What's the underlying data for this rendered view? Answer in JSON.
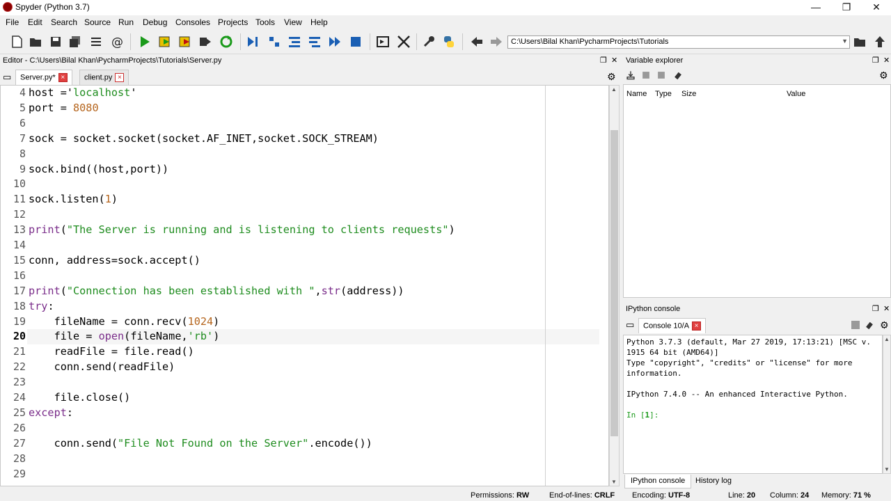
{
  "window": {
    "title": "Spyder (Python 3.7)",
    "minimize": "—",
    "restore": "❐",
    "close": "✕"
  },
  "menu": [
    "File",
    "Edit",
    "Search",
    "Source",
    "Run",
    "Debug",
    "Consoles",
    "Projects",
    "Tools",
    "View",
    "Help"
  ],
  "toolbar": {
    "path": "C:\\Users\\Bilal Khan\\PycharmProjects\\Tutorials"
  },
  "editor": {
    "header": "Editor - C:\\Users\\Bilal Khan\\PycharmProjects\\Tutorials\\Server.py",
    "tabs": [
      "Server.py*",
      "client.py"
    ],
    "current_line": "20",
    "lines": [
      {
        "n": "4",
        "html": "host ='<span class=\"str\">localhost</span>'"
      },
      {
        "n": "5",
        "html": "port = <span class=\"num\">8080</span>"
      },
      {
        "n": "6",
        "html": ""
      },
      {
        "n": "7",
        "html": "sock = socket.socket(socket.AF_INET,socket.SOCK_STREAM)"
      },
      {
        "n": "8",
        "html": ""
      },
      {
        "n": "9",
        "html": "sock.bind((host,port))"
      },
      {
        "n": "10",
        "html": ""
      },
      {
        "n": "11",
        "html": "sock.listen(<span class=\"num\">1</span>)"
      },
      {
        "n": "12",
        "html": ""
      },
      {
        "n": "13",
        "html": "<span class=\"kw\">print</span>(<span class=\"str\">\"The Server is running and is listening to clients requests\"</span>)"
      },
      {
        "n": "14",
        "html": ""
      },
      {
        "n": "15",
        "html": "conn, address=sock.accept()"
      },
      {
        "n": "16",
        "html": ""
      },
      {
        "n": "17",
        "html": "<span class=\"kw\">print</span>(<span class=\"str\">\"Connection has been established with \"</span>,<span class=\"kw\">str</span>(address))"
      },
      {
        "n": "18",
        "html": "<span class=\"kw\">try</span>:"
      },
      {
        "n": "19",
        "html": "    fileName = conn.recv(<span class=\"num\">1024</span>)"
      },
      {
        "n": "20",
        "html": "    file = <span class=\"kw\">open</span>(fileName,<span class=\"str\">'rb'</span>)"
      },
      {
        "n": "21",
        "html": "    readFile = file.read()"
      },
      {
        "n": "22",
        "html": "    conn.send(readFile)"
      },
      {
        "n": "23",
        "html": ""
      },
      {
        "n": "24",
        "html": "    file.close()"
      },
      {
        "n": "25",
        "html": "<span class=\"kw\">except</span>:"
      },
      {
        "n": "26",
        "html": ""
      },
      {
        "n": "27",
        "html": "    conn.send(<span class=\"str\">\"File Not Found on the Server\"</span>.encode())"
      },
      {
        "n": "28",
        "html": ""
      },
      {
        "n": "29",
        "html": ""
      }
    ]
  },
  "variable_explorer": {
    "title": "Variable explorer",
    "columns": [
      "Name",
      "Type",
      "Size",
      "Value"
    ]
  },
  "ipython": {
    "title": "IPython console",
    "tab": "Console 10/A",
    "output": [
      "Python 3.7.3 (default, Mar 27 2019, 17:13:21) [MSC v.",
      "1915 64 bit (AMD64)]",
      "Type \"copyright\", \"credits\" or \"license\" for more",
      "information.",
      "",
      "IPython 7.4.0 -- An enhanced Interactive Python.",
      "",
      "In [1]:"
    ],
    "bottom_tabs": [
      "IPython console",
      "History log"
    ]
  },
  "status": {
    "permissions_label": "Permissions:",
    "permissions": "RW",
    "eol_label": "End-of-lines:",
    "eol": "CRLF",
    "encoding_label": "Encoding:",
    "encoding": "UTF-8",
    "line_label": "Line:",
    "line": "20",
    "column_label": "Column:",
    "column": "24",
    "memory_label": "Memory:",
    "memory": "71 %"
  }
}
